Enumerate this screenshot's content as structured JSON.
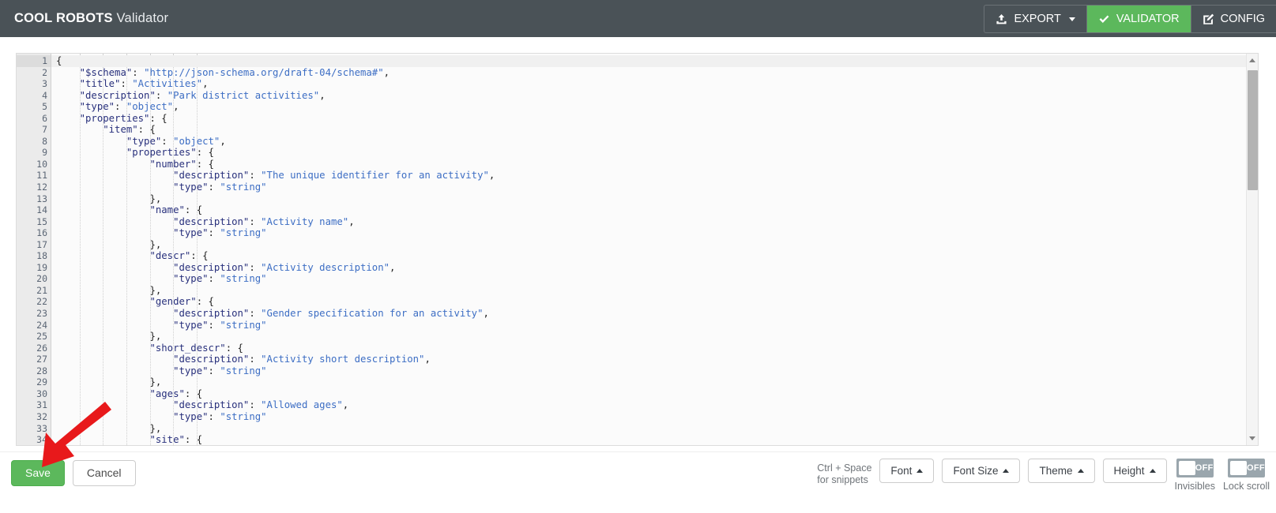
{
  "header": {
    "brand_bold": "COOL ROBOTS",
    "brand_light": "Validator",
    "nav": [
      {
        "label": "EXPORT",
        "icon": "upload-icon",
        "active": false,
        "caret": true
      },
      {
        "label": "VALIDATOR",
        "icon": "check-icon",
        "active": true,
        "caret": false
      },
      {
        "label": "CONFIG",
        "icon": "pencil-square-icon",
        "active": false,
        "caret": false
      }
    ]
  },
  "editor": {
    "active_line": 1,
    "fold_lines": [
      1,
      6,
      7,
      9,
      10,
      14,
      18,
      22,
      26,
      30
    ],
    "lines": [
      {
        "n": 1,
        "text": "{"
      },
      {
        "n": 2,
        "text": "    \"$schema\": \"http://json-schema.org/draft-04/schema#\","
      },
      {
        "n": 3,
        "text": "    \"title\": \"Activities\","
      },
      {
        "n": 4,
        "text": "    \"description\": \"Park district activities\","
      },
      {
        "n": 5,
        "text": "    \"type\": \"object\","
      },
      {
        "n": 6,
        "text": "    \"properties\": {"
      },
      {
        "n": 7,
        "text": "        \"item\": {"
      },
      {
        "n": 8,
        "text": "            \"type\": \"object\","
      },
      {
        "n": 9,
        "text": "            \"properties\": {"
      },
      {
        "n": 10,
        "text": "                \"number\": {"
      },
      {
        "n": 11,
        "text": "                    \"description\": \"The unique identifier for an activity\","
      },
      {
        "n": 12,
        "text": "                    \"type\": \"string\""
      },
      {
        "n": 13,
        "text": "                },"
      },
      {
        "n": 14,
        "text": "                \"name\": {"
      },
      {
        "n": 15,
        "text": "                    \"description\": \"Activity name\","
      },
      {
        "n": 16,
        "text": "                    \"type\": \"string\""
      },
      {
        "n": 17,
        "text": "                },"
      },
      {
        "n": 18,
        "text": "                \"descr\": {"
      },
      {
        "n": 19,
        "text": "                    \"description\": \"Activity description\","
      },
      {
        "n": 20,
        "text": "                    \"type\": \"string\""
      },
      {
        "n": 21,
        "text": "                },"
      },
      {
        "n": 22,
        "text": "                \"gender\": {"
      },
      {
        "n": 23,
        "text": "                    \"description\": \"Gender specification for an activity\","
      },
      {
        "n": 24,
        "text": "                    \"type\": \"string\""
      },
      {
        "n": 25,
        "text": "                },"
      },
      {
        "n": 26,
        "text": "                \"short_descr\": {"
      },
      {
        "n": 27,
        "text": "                    \"description\": \"Activity short description\","
      },
      {
        "n": 28,
        "text": "                    \"type\": \"string\""
      },
      {
        "n": 29,
        "text": "                },"
      },
      {
        "n": 30,
        "text": "                \"ages\": {"
      },
      {
        "n": 31,
        "text": "                    \"description\": \"Allowed ages\","
      },
      {
        "n": 32,
        "text": "                    \"type\": \"string\""
      },
      {
        "n": 33,
        "text": "                },"
      },
      {
        "n": 34,
        "text": "                \"site\": {"
      }
    ]
  },
  "footer": {
    "save_label": "Save",
    "cancel_label": "Cancel",
    "snippet_hint_line1": "Ctrl + Space",
    "snippet_hint_line2": "for snippets",
    "tool_buttons": [
      {
        "label": "Font"
      },
      {
        "label": "Font Size"
      },
      {
        "label": "Theme"
      },
      {
        "label": "Height"
      }
    ],
    "toggles": [
      {
        "label": "Invisibles",
        "state": "OFF"
      },
      {
        "label": "Lock scroll",
        "state": "OFF"
      }
    ]
  },
  "annotation": {
    "type": "red-arrow",
    "points_to": "save-button",
    "color": "#e8191b"
  },
  "colors": {
    "header_bg": "#4a5257",
    "accent_green": "#5cb85c",
    "editor_bg": "#fbfbfb",
    "gutter_bg": "#ebebeb",
    "json_key": "#28307c",
    "json_string": "#3d6ec4"
  }
}
